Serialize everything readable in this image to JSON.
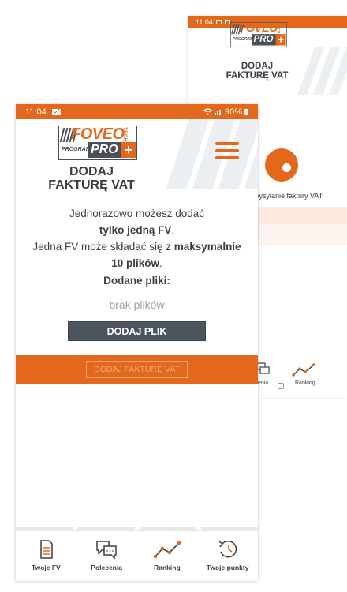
{
  "back_screen": {
    "status_time": "11:04",
    "logo": {
      "brand": "FOVEO",
      "sub": "TECH",
      "program": "PROGRAM",
      "pro": "PRO",
      "plus": "+"
    },
    "title_line1": "DODAJ",
    "title_line2": "FAKTURĘ VAT",
    "caption": "wysyłanie faktury VAT",
    "nav_labels": [
      "lecenia",
      "Ranking"
    ]
  },
  "status_bar": {
    "time": "11:04",
    "battery": "90%"
  },
  "logo": {
    "brand": "FOVEO",
    "sub": "TECH",
    "program": "PROGRAM",
    "pro": "PRO",
    "plus": "+"
  },
  "page": {
    "title_line1": "DODAJ",
    "title_line2": "FAKTURĘ VAT"
  },
  "description": {
    "line1": "Jednorazowo możesz dodać",
    "line2_bold": "tylko jedną FV",
    "line2_end": ".",
    "line3_start": "Jedna FV może składać się z ",
    "line3_bold": "maksymalnie",
    "line4_bold": "10 plików",
    "line4_end": "."
  },
  "files": {
    "label": "Dodane pliki:",
    "empty_text": "brak plików"
  },
  "buttons": {
    "add_file": "DODAJ PLIK",
    "add_invoice": "DODAJ FAKTURĘ VAT"
  },
  "colors": {
    "accent": "#e3681b",
    "dark": "#4c555e",
    "text": "#3a3f46"
  },
  "bottom_nav": [
    {
      "label": "Twoje FV",
      "icon": "document-icon"
    },
    {
      "label": "Polecenia",
      "icon": "chat-bubbles-icon"
    },
    {
      "label": "Ranking",
      "icon": "trend-line-icon"
    },
    {
      "label": "Twoje punkty",
      "icon": "history-clock-icon"
    }
  ]
}
